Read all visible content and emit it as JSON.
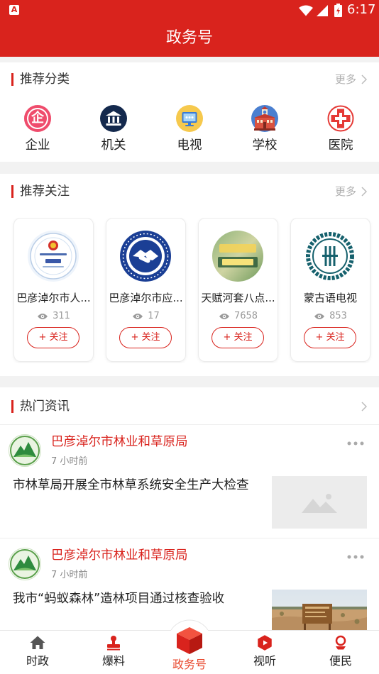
{
  "status_bar": {
    "notification_glyph": "A",
    "time": "6:17"
  },
  "header": {
    "title": "政务号"
  },
  "theme": {
    "primary": "#d9231d",
    "active_tab_label": "#e8472c",
    "page_background": "#f2f2f2"
  },
  "categories": {
    "title": "推荐分类",
    "more": "更多",
    "items": [
      {
        "label": "企业",
        "icon": "enterprise-icon",
        "glyph": "企"
      },
      {
        "label": "机关",
        "icon": "government-building-icon"
      },
      {
        "label": "电视",
        "icon": "tv-icon"
      },
      {
        "label": "学校",
        "icon": "school-icon"
      },
      {
        "label": "医院",
        "icon": "hospital-cross-icon"
      }
    ]
  },
  "follows": {
    "title": "推荐关注",
    "more": "更多",
    "follow_label": "+ 关注",
    "cards": [
      {
        "name": "巴彦淖尔市人...",
        "views": "311",
        "avatar": "procuratorate-logo"
      },
      {
        "name": "巴彦淖尔市应...",
        "views": "17",
        "avatar": "emergency-management-logo"
      },
      {
        "name": "天赋河套八点...",
        "views": "7658",
        "avatar": "news-broadcast-logo"
      },
      {
        "name": "蒙古语电视",
        "views": "853",
        "avatar": "mongolian-tv-logo"
      }
    ]
  },
  "news": {
    "title": "热门资讯",
    "items": [
      {
        "source": "巴彦淖尔市林业和草原局",
        "time": "7 小时前",
        "title": "市林草局开展全市林草系统安全生产大检查",
        "thumbnail": "image-placeholder-icon"
      },
      {
        "source": "巴彦淖尔市林业和草原局",
        "time": "7 小时前",
        "title": "我市“蚂蚁森林”造林项目通过核查验收",
        "thumbnail": "desert-afforestation-photo"
      }
    ]
  },
  "tabbar": {
    "items": [
      {
        "label": "时政",
        "icon": "home-icon",
        "active": false
      },
      {
        "label": "爆料",
        "icon": "stamp-icon",
        "active": false
      },
      {
        "label": "政务号",
        "icon": "cube-icon",
        "active": true
      },
      {
        "label": "视听",
        "icon": "play-hexagon-icon",
        "active": false
      },
      {
        "label": "便民",
        "icon": "person-pin-icon",
        "active": false
      }
    ]
  }
}
